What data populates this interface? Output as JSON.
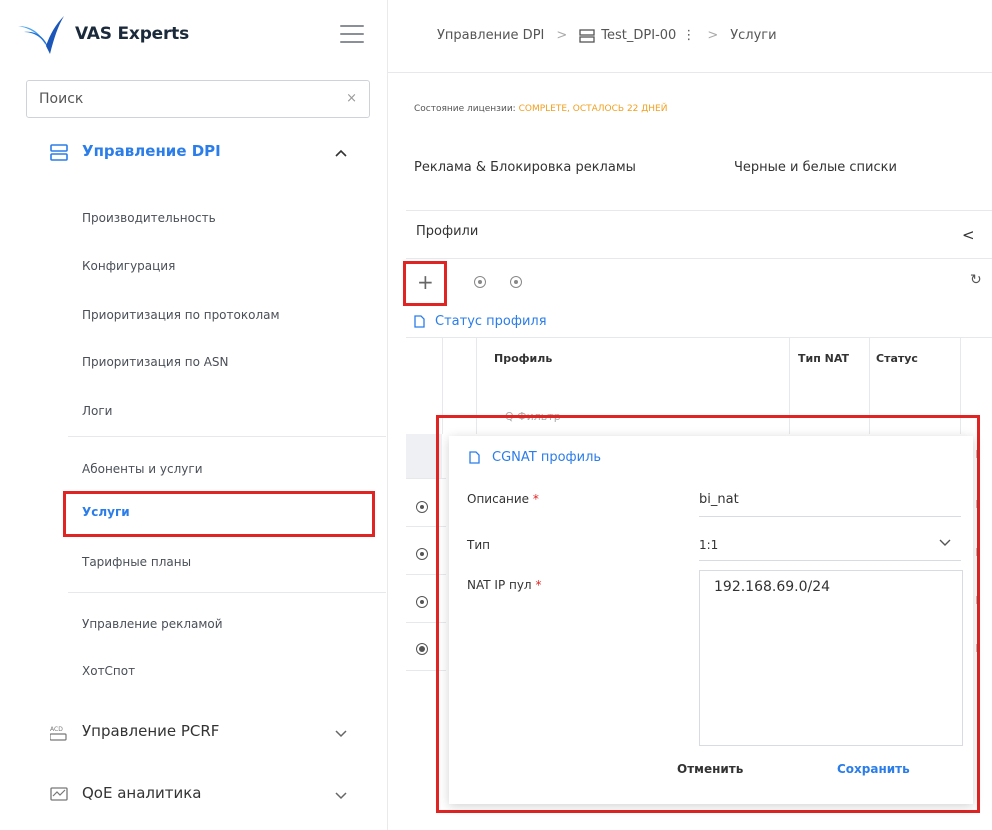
{
  "app": {
    "brand": "VAS Experts",
    "colors": {
      "accent": "#2b7de9",
      "highlight": "#e02424",
      "warning": "#f0a020"
    }
  },
  "sidebar": {
    "search_placeholder": "Поиск",
    "clear_icon": "×",
    "group_dpi": {
      "label": "Управление DPI",
      "items": [
        "Производительность",
        "Конфигурация",
        "Приоритизация по протоколам",
        "Приоритизация по ASN",
        "Логи",
        "Абоненты и услуги",
        "Услуги",
        "Тарифные планы",
        "Управление рекламой",
        "ХотСпот"
      ],
      "selected": "Услуги"
    },
    "group_pcrf": {
      "label": "Управление PCRF"
    },
    "group_qoe": {
      "label": "QoE аналитика"
    }
  },
  "breadcrumb": {
    "root": "Управление DPI",
    "server": "Test_DPI-00",
    "server_menu": "⋮",
    "current": "Услуги",
    "sep": ">"
  },
  "license": {
    "label": "Состояние лицензии:",
    "status": "COMPLETE, ОСТАЛОСЬ 22 ДНЕЙ"
  },
  "tabs": {
    "ads": "Реклама & Блокировка рекламы",
    "lists": "Черные и белые списки"
  },
  "profiles": {
    "title": "Профили",
    "collapse": "<",
    "add": "+",
    "refresh": "↻",
    "status_link": "Статус профиля",
    "columns": {
      "profile": "Профиль",
      "nat_type": "Тип NAT",
      "status": "Статус"
    },
    "filter_placeholder": "Q Фильтр"
  },
  "modal": {
    "title": "CGNAT профиль",
    "description_label": "Описание",
    "description_value": "bi_nat",
    "type_label": "Тип",
    "type_value": "1:1",
    "pool_label": "NAT IP пул",
    "pool_value": "192.168.69.0/24",
    "required_mark": "*",
    "cancel": "Отменить",
    "save": "Сохранить"
  }
}
